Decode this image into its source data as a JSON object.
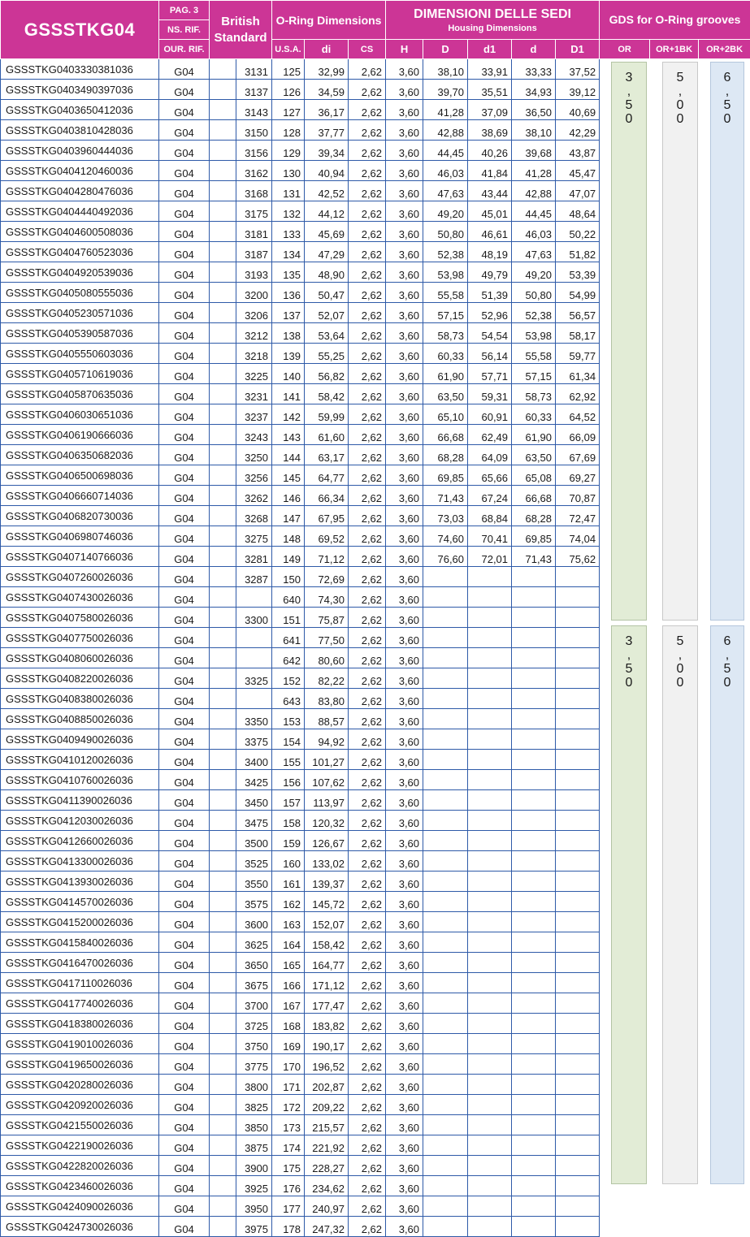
{
  "header": {
    "title": "GSSSTKG04",
    "pag": "PAG. 3",
    "ns_rif": "NS. RIF.",
    "our_rif": "OUR. RIF.",
    "british_standard": "British Standard",
    "oring_dimensions": "O-Ring Dimensions",
    "dimensioni": "DIMENSIONI DELLE SEDI",
    "housing": "Housing Dimensions",
    "gds": "GDS for O-Ring grooves",
    "col_usa": "U.S.A.",
    "col_di": "di",
    "col_cs": "CS",
    "col_H": "H",
    "col_D": "D",
    "col_d1": "d1",
    "col_d": "d",
    "col_D1": "D1",
    "col_or": "OR",
    "col_or1bk": "OR+1BK",
    "col_or2bk": "OR+2BK"
  },
  "gds_values": {
    "or": [
      "3",
      ",",
      "5",
      "0"
    ],
    "or1bk": [
      "5",
      ",",
      "0",
      "0"
    ],
    "or2bk": [
      "6",
      ",",
      "5",
      "0"
    ]
  },
  "rows": [
    [
      "GSSSTKG0403330381036",
      "G04",
      "3131",
      "125",
      "32,99",
      "2,62",
      "3,60",
      "38,10",
      "33,91",
      "33,33",
      "37,52"
    ],
    [
      "GSSSTKG0403490397036",
      "G04",
      "3137",
      "126",
      "34,59",
      "2,62",
      "3,60",
      "39,70",
      "35,51",
      "34,93",
      "39,12"
    ],
    [
      "GSSSTKG0403650412036",
      "G04",
      "3143",
      "127",
      "36,17",
      "2,62",
      "3,60",
      "41,28",
      "37,09",
      "36,50",
      "40,69"
    ],
    [
      "GSSSTKG0403810428036",
      "G04",
      "3150",
      "128",
      "37,77",
      "2,62",
      "3,60",
      "42,88",
      "38,69",
      "38,10",
      "42,29"
    ],
    [
      "GSSSTKG0403960444036",
      "G04",
      "3156",
      "129",
      "39,34",
      "2,62",
      "3,60",
      "44,45",
      "40,26",
      "39,68",
      "43,87"
    ],
    [
      "GSSSTKG0404120460036",
      "G04",
      "3162",
      "130",
      "40,94",
      "2,62",
      "3,60",
      "46,03",
      "41,84",
      "41,28",
      "45,47"
    ],
    [
      "GSSSTKG0404280476036",
      "G04",
      "3168",
      "131",
      "42,52",
      "2,62",
      "3,60",
      "47,63",
      "43,44",
      "42,88",
      "47,07"
    ],
    [
      "GSSSTKG0404440492036",
      "G04",
      "3175",
      "132",
      "44,12",
      "2,62",
      "3,60",
      "49,20",
      "45,01",
      "44,45",
      "48,64"
    ],
    [
      "GSSSTKG0404600508036",
      "G04",
      "3181",
      "133",
      "45,69",
      "2,62",
      "3,60",
      "50,80",
      "46,61",
      "46,03",
      "50,22"
    ],
    [
      "GSSSTKG0404760523036",
      "G04",
      "3187",
      "134",
      "47,29",
      "2,62",
      "3,60",
      "52,38",
      "48,19",
      "47,63",
      "51,82"
    ],
    [
      "GSSSTKG0404920539036",
      "G04",
      "3193",
      "135",
      "48,90",
      "2,62",
      "3,60",
      "53,98",
      "49,79",
      "49,20",
      "53,39"
    ],
    [
      "GSSSTKG0405080555036",
      "G04",
      "3200",
      "136",
      "50,47",
      "2,62",
      "3,60",
      "55,58",
      "51,39",
      "50,80",
      "54,99"
    ],
    [
      "GSSSTKG0405230571036",
      "G04",
      "3206",
      "137",
      "52,07",
      "2,62",
      "3,60",
      "57,15",
      "52,96",
      "52,38",
      "56,57"
    ],
    [
      "GSSSTKG0405390587036",
      "G04",
      "3212",
      "138",
      "53,64",
      "2,62",
      "3,60",
      "58,73",
      "54,54",
      "53,98",
      "58,17"
    ],
    [
      "GSSSTKG0405550603036",
      "G04",
      "3218",
      "139",
      "55,25",
      "2,62",
      "3,60",
      "60,33",
      "56,14",
      "55,58",
      "59,77"
    ],
    [
      "GSSSTKG0405710619036",
      "G04",
      "3225",
      "140",
      "56,82",
      "2,62",
      "3,60",
      "61,90",
      "57,71",
      "57,15",
      "61,34"
    ],
    [
      "GSSSTKG0405870635036",
      "G04",
      "3231",
      "141",
      "58,42",
      "2,62",
      "3,60",
      "63,50",
      "59,31",
      "58,73",
      "62,92"
    ],
    [
      "GSSSTKG0406030651036",
      "G04",
      "3237",
      "142",
      "59,99",
      "2,62",
      "3,60",
      "65,10",
      "60,91",
      "60,33",
      "64,52"
    ],
    [
      "GSSSTKG0406190666036",
      "G04",
      "3243",
      "143",
      "61,60",
      "2,62",
      "3,60",
      "66,68",
      "62,49",
      "61,90",
      "66,09"
    ],
    [
      "GSSSTKG0406350682036",
      "G04",
      "3250",
      "144",
      "63,17",
      "2,62",
      "3,60",
      "68,28",
      "64,09",
      "63,50",
      "67,69"
    ],
    [
      "GSSSTKG0406500698036",
      "G04",
      "3256",
      "145",
      "64,77",
      "2,62",
      "3,60",
      "69,85",
      "65,66",
      "65,08",
      "69,27"
    ],
    [
      "GSSSTKG0406660714036",
      "G04",
      "3262",
      "146",
      "66,34",
      "2,62",
      "3,60",
      "71,43",
      "67,24",
      "66,68",
      "70,87"
    ],
    [
      "GSSSTKG0406820730036",
      "G04",
      "3268",
      "147",
      "67,95",
      "2,62",
      "3,60",
      "73,03",
      "68,84",
      "68,28",
      "72,47"
    ],
    [
      "GSSSTKG0406980746036",
      "G04",
      "3275",
      "148",
      "69,52",
      "2,62",
      "3,60",
      "74,60",
      "70,41",
      "69,85",
      "74,04"
    ],
    [
      "GSSSTKG0407140766036",
      "G04",
      "3281",
      "149",
      "71,12",
      "2,62",
      "3,60",
      "76,60",
      "72,01",
      "71,43",
      "75,62"
    ],
    [
      "GSSSTKG0407260026036",
      "G04",
      "3287",
      "150",
      "72,69",
      "2,62",
      "3,60",
      "",
      "",
      "",
      ""
    ],
    [
      "GSSSTKG0407430026036",
      "G04",
      "",
      "640",
      "74,30",
      "2,62",
      "3,60",
      "",
      "",
      "",
      ""
    ],
    [
      "GSSSTKG0407580026036",
      "G04",
      "3300",
      "151",
      "75,87",
      "2,62",
      "3,60",
      "",
      "",
      "",
      ""
    ],
    [
      "GSSSTKG0407750026036",
      "G04",
      "",
      "641",
      "77,50",
      "2,62",
      "3,60",
      "",
      "",
      "",
      ""
    ],
    [
      "GSSSTKG0408060026036",
      "G04",
      "",
      "642",
      "80,60",
      "2,62",
      "3,60",
      "",
      "",
      "",
      ""
    ],
    [
      "GSSSTKG0408220026036",
      "G04",
      "3325",
      "152",
      "82,22",
      "2,62",
      "3,60",
      "",
      "",
      "",
      ""
    ],
    [
      "GSSSTKG0408380026036",
      "G04",
      "",
      "643",
      "83,80",
      "2,62",
      "3,60",
      "",
      "",
      "",
      ""
    ],
    [
      "GSSSTKG0408850026036",
      "G04",
      "3350",
      "153",
      "88,57",
      "2,62",
      "3,60",
      "",
      "",
      "",
      ""
    ],
    [
      "GSSSTKG0409490026036",
      "G04",
      "3375",
      "154",
      "94,92",
      "2,62",
      "3,60",
      "",
      "",
      "",
      ""
    ],
    [
      "GSSSTKG0410120026036",
      "G04",
      "3400",
      "155",
      "101,27",
      "2,62",
      "3,60",
      "",
      "",
      "",
      ""
    ],
    [
      "GSSSTKG0410760026036",
      "G04",
      "3425",
      "156",
      "107,62",
      "2,62",
      "3,60",
      "",
      "",
      "",
      ""
    ],
    [
      "GSSSTKG0411390026036",
      "G04",
      "3450",
      "157",
      "113,97",
      "2,62",
      "3,60",
      "",
      "",
      "",
      ""
    ],
    [
      "GSSSTKG0412030026036",
      "G04",
      "3475",
      "158",
      "120,32",
      "2,62",
      "3,60",
      "",
      "",
      "",
      ""
    ],
    [
      "GSSSTKG0412660026036",
      "G04",
      "3500",
      "159",
      "126,67",
      "2,62",
      "3,60",
      "",
      "",
      "",
      ""
    ],
    [
      "GSSSTKG0413300026036",
      "G04",
      "3525",
      "160",
      "133,02",
      "2,62",
      "3,60",
      "",
      "",
      "",
      ""
    ],
    [
      "GSSSTKG0413930026036",
      "G04",
      "3550",
      "161",
      "139,37",
      "2,62",
      "3,60",
      "",
      "",
      "",
      ""
    ],
    [
      "GSSSTKG0414570026036",
      "G04",
      "3575",
      "162",
      "145,72",
      "2,62",
      "3,60",
      "",
      "",
      "",
      ""
    ],
    [
      "GSSSTKG0415200026036",
      "G04",
      "3600",
      "163",
      "152,07",
      "2,62",
      "3,60",
      "",
      "",
      "",
      ""
    ],
    [
      "GSSSTKG0415840026036",
      "G04",
      "3625",
      "164",
      "158,42",
      "2,62",
      "3,60",
      "",
      "",
      "",
      ""
    ],
    [
      "GSSSTKG0416470026036",
      "G04",
      "3650",
      "165",
      "164,77",
      "2,62",
      "3,60",
      "",
      "",
      "",
      ""
    ],
    [
      "GSSSTKG0417110026036",
      "G04",
      "3675",
      "166",
      "171,12",
      "2,62",
      "3,60",
      "",
      "",
      "",
      ""
    ],
    [
      "GSSSTKG0417740026036",
      "G04",
      "3700",
      "167",
      "177,47",
      "2,62",
      "3,60",
      "",
      "",
      "",
      ""
    ],
    [
      "GSSSTKG0418380026036",
      "G04",
      "3725",
      "168",
      "183,82",
      "2,62",
      "3,60",
      "",
      "",
      "",
      ""
    ],
    [
      "GSSSTKG0419010026036",
      "G04",
      "3750",
      "169",
      "190,17",
      "2,62",
      "3,60",
      "",
      "",
      "",
      ""
    ],
    [
      "GSSSTKG0419650026036",
      "G04",
      "3775",
      "170",
      "196,52",
      "2,62",
      "3,60",
      "",
      "",
      "",
      ""
    ],
    [
      "GSSSTKG0420280026036",
      "G04",
      "3800",
      "171",
      "202,87",
      "2,62",
      "3,60",
      "",
      "",
      "",
      ""
    ],
    [
      "GSSSTKG0420920026036",
      "G04",
      "3825",
      "172",
      "209,22",
      "2,62",
      "3,60",
      "",
      "",
      "",
      ""
    ],
    [
      "GSSSTKG0421550026036",
      "G04",
      "3850",
      "173",
      "215,57",
      "2,62",
      "3,60",
      "",
      "",
      "",
      ""
    ],
    [
      "GSSSTKG0422190026036",
      "G04",
      "3875",
      "174",
      "221,92",
      "2,62",
      "3,60",
      "",
      "",
      "",
      ""
    ],
    [
      "GSSSTKG0422820026036",
      "G04",
      "3900",
      "175",
      "228,27",
      "2,62",
      "3,60",
      "",
      "",
      "",
      ""
    ],
    [
      "GSSSTKG0423460026036",
      "G04",
      "3925",
      "176",
      "234,62",
      "2,62",
      "3,60",
      "",
      "",
      "",
      ""
    ],
    [
      "GSSSTKG0424090026036",
      "G04",
      "3950",
      "177",
      "240,97",
      "2,62",
      "3,60",
      "",
      "",
      "",
      ""
    ],
    [
      "GSSSTKG0424730026036",
      "G04",
      "3975",
      "178",
      "247,32",
      "2,62",
      "3,60",
      "",
      "",
      "",
      ""
    ]
  ]
}
